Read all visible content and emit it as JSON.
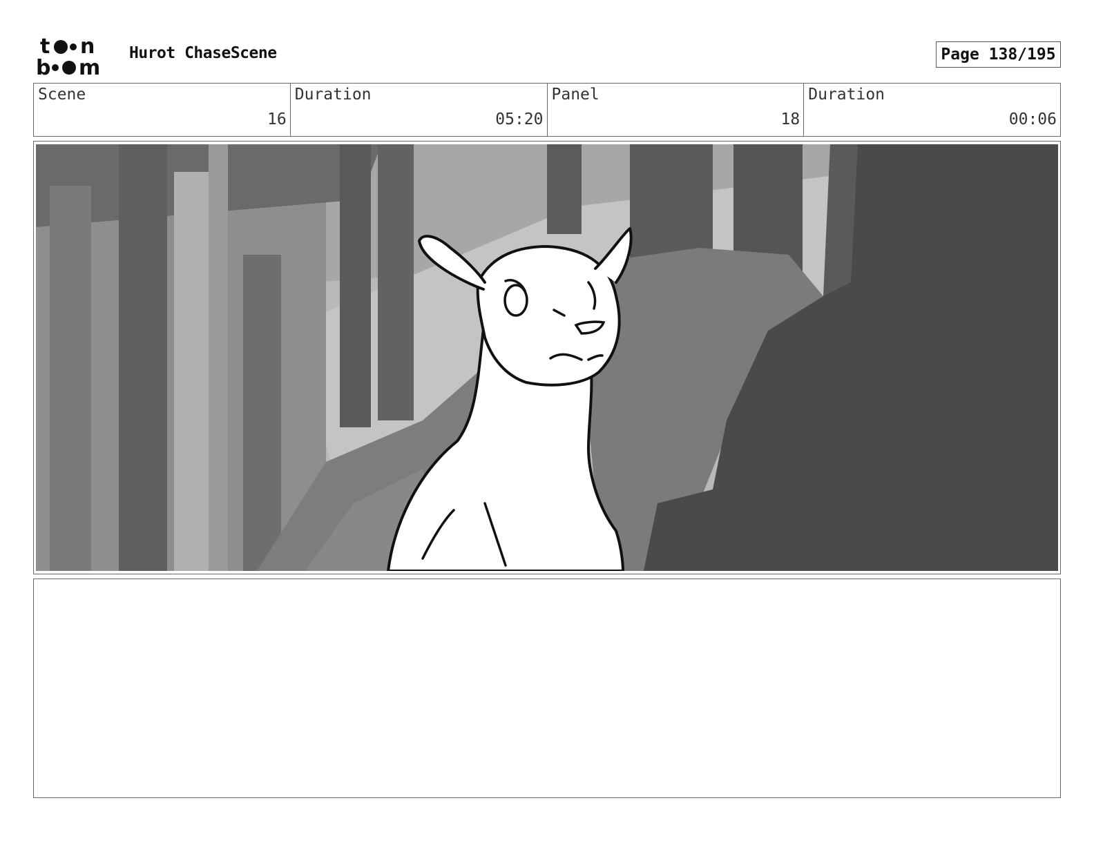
{
  "header": {
    "logo_text": "toon boom",
    "title": "Hurot ChaseScene",
    "page": "Page 138/195"
  },
  "info": {
    "scene_label": "Scene",
    "scene_value": "16",
    "scene_duration_label": "Duration",
    "scene_duration_value": "05:20",
    "panel_label": "Panel",
    "panel_value": "18",
    "panel_duration_label": "Duration",
    "panel_duration_value": "00:06"
  },
  "colors": {
    "border": "#666666",
    "ink": "#111111",
    "forest_light": "#c8c8c8",
    "forest_mid": "#8a8a8a",
    "forest_dark": "#4a4a4a"
  }
}
